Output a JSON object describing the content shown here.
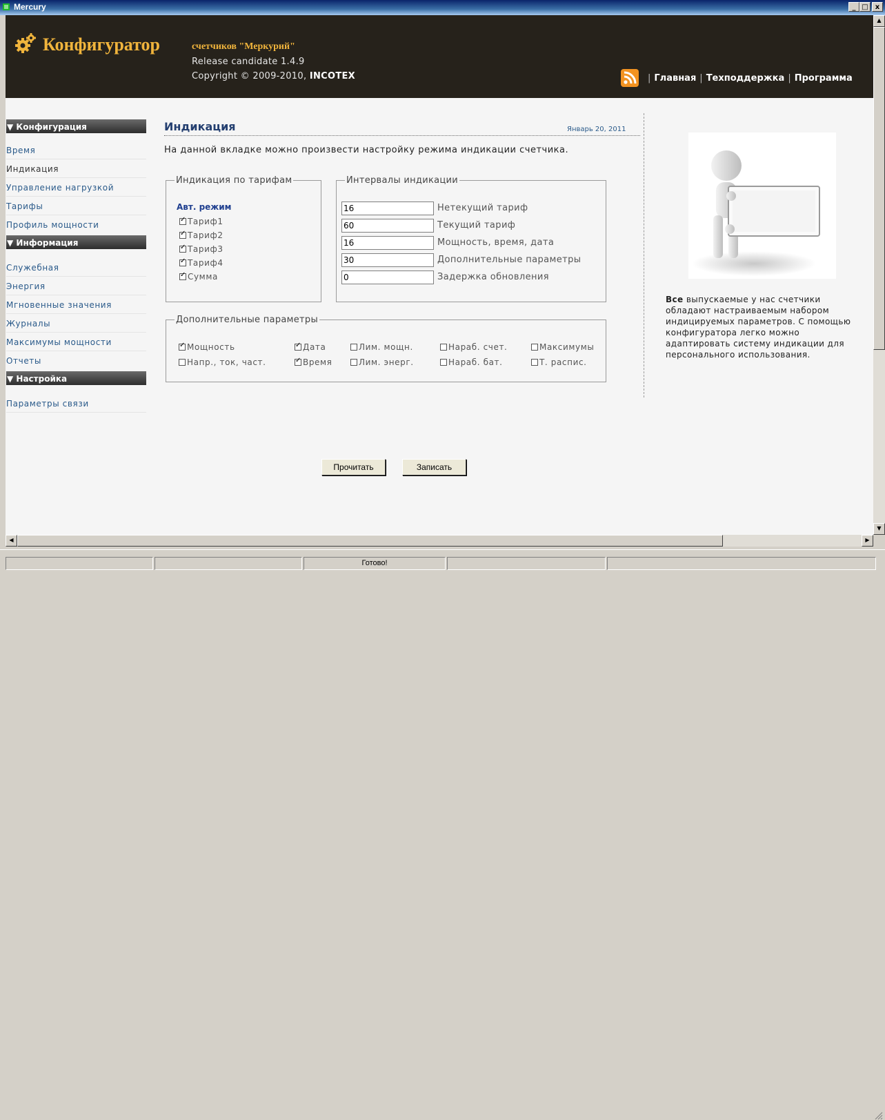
{
  "window": {
    "title": "Mercury",
    "min_label": "_",
    "max_label": "□",
    "close_label": "x"
  },
  "header": {
    "brand": "Конфигуратор",
    "subtitle": "счетчиков \"Меркурий\"",
    "release": "Release candidate 1.4.9",
    "copyright_prefix": "Copyright © 2009-2010, ",
    "copyright_company": "INCOTEX",
    "nav": [
      "Главная",
      "Техподдержка",
      "Программа"
    ],
    "nav_separator": "|",
    "icon": "rss-icon"
  },
  "sidebar": {
    "sections": [
      {
        "title": "▼ Конфигурация",
        "items": [
          "Время",
          "Индикация",
          "Управление нагрузкой",
          "Тарифы",
          "Профиль мощности"
        ]
      },
      {
        "title": "▼ Информация",
        "items": [
          "Служебная",
          "Энергия",
          "Мгновенные значения",
          "Журналы",
          "Максимумы мощности",
          "Отчеты"
        ]
      },
      {
        "title": "▼ Настройка",
        "items": [
          "Параметры связи"
        ]
      }
    ],
    "active_item": "Индикация"
  },
  "main": {
    "title": "Индикация",
    "date": "Январь 20, 2011",
    "description": "На данной вкладке можно произвести настройку режима индикации счетчика.",
    "tariffs": {
      "legend": "Индикация по тарифам",
      "auto_mode": "Авт. режим",
      "items": [
        {
          "label": "Тариф1",
          "checked": true
        },
        {
          "label": "Тариф2",
          "checked": true
        },
        {
          "label": "Тариф3",
          "checked": true
        },
        {
          "label": "Тариф4",
          "checked": true
        },
        {
          "label": "Сумма",
          "checked": true
        }
      ]
    },
    "intervals": {
      "legend": "Интервалы индикации",
      "rows": [
        {
          "value": "16",
          "label": "Нетекущий тариф"
        },
        {
          "value": "60",
          "label": "Текущий тариф"
        },
        {
          "value": "16",
          "label": "Мощность, время, дата"
        },
        {
          "value": "30",
          "label": "Дополнительные параметры"
        },
        {
          "value": "0",
          "label": "Задержка обновления"
        }
      ]
    },
    "extra": {
      "legend": "Дополнительные параметры",
      "row1": [
        {
          "label": "Мощность",
          "checked": true
        },
        {
          "label": "Дата",
          "checked": true
        },
        {
          "label": "Лим. мощн.",
          "checked": false
        },
        {
          "label": "Нараб. счет.",
          "checked": false
        },
        {
          "label": "Максимумы",
          "checked": false
        }
      ],
      "row2": [
        {
          "label": "Напр., ток, част.",
          "checked": false
        },
        {
          "label": "Время",
          "checked": true
        },
        {
          "label": "Лим. энерг.",
          "checked": false
        },
        {
          "label": "Нараб. бат.",
          "checked": false
        },
        {
          "label": "Т. распис.",
          "checked": false
        }
      ]
    },
    "buttons": {
      "read": "Прочитать",
      "write": "Записать"
    }
  },
  "aside": {
    "bold": "Все",
    "text": " выпускаемые у нас счетчики обладают настраиваемым набором индицируемых параметров. С помощью конфигуратора легко можно адаптировать систему индикации для персонального использования."
  },
  "statusbar": {
    "status": "Готово!"
  },
  "colors": {
    "header_bg": "#26221b",
    "brand": "#f0b43c",
    "link": "#2a5a8a",
    "rss": "#f39321"
  }
}
